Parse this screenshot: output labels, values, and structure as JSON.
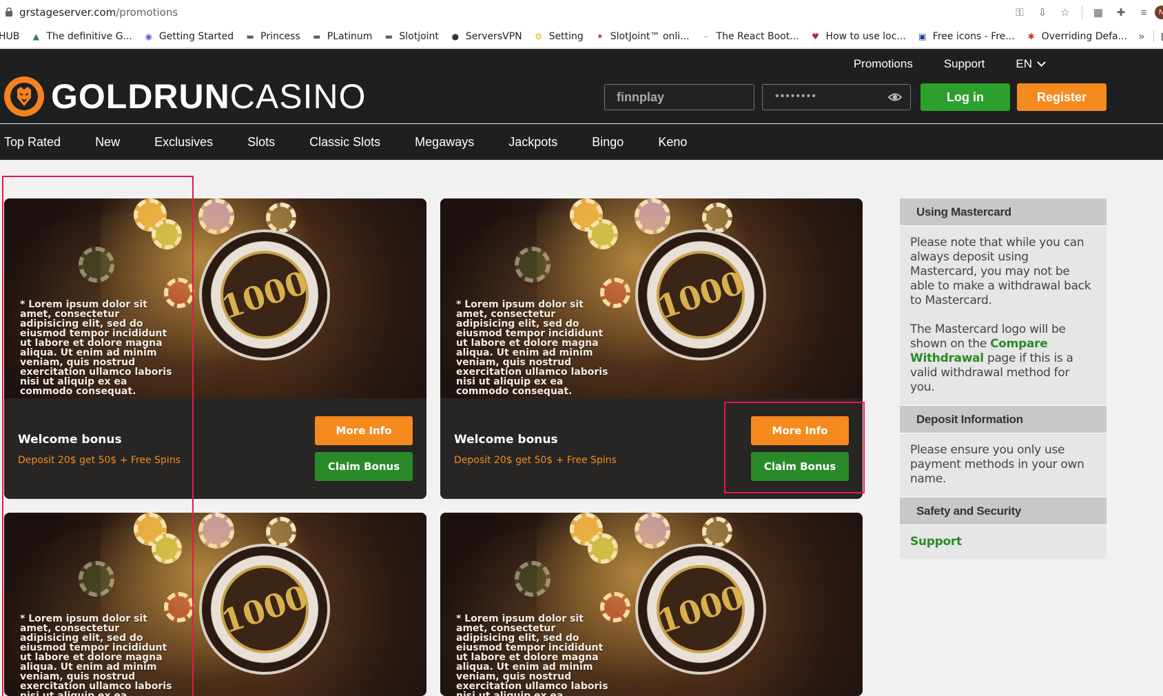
{
  "browser": {
    "url_host": "grstageserver.com",
    "url_path": "/promotions",
    "avatar_letter": "N",
    "bookmarks": [
      {
        "label": "HUB",
        "icon": "none"
      },
      {
        "label": "The definitive G...",
        "icon": "triangle-icon"
      },
      {
        "label": "Getting Started",
        "icon": "eye-logo-icon"
      },
      {
        "label": "Princess",
        "icon": "folder-icon"
      },
      {
        "label": "PLatinum",
        "icon": "folder-icon"
      },
      {
        "label": "Slotjoint",
        "icon": "folder-icon"
      },
      {
        "label": "ServersVPN",
        "icon": "globe-icon"
      },
      {
        "label": "Setting",
        "icon": "setting-icon"
      },
      {
        "label": "SlotJoint™ onli...",
        "icon": "star-logo-icon"
      },
      {
        "label": "The React Boot...",
        "icon": "bar-icon"
      },
      {
        "label": "How to use loc...",
        "icon": "gem-icon"
      },
      {
        "label": "Free icons - Fre...",
        "icon": "flaticon-icon"
      },
      {
        "label": "Overriding Defa...",
        "icon": "asterisk-icon"
      }
    ],
    "bookmarks_more": "»",
    "reading_list": "Readi"
  },
  "header": {
    "top_links": [
      "Promotions",
      "Support",
      "EN"
    ],
    "logo_bold": "GOLDRUN",
    "logo_light": "CASINO",
    "username_value": "finnplay",
    "password_mask": "••••••••",
    "login_label": "Log in",
    "register_label": "Register"
  },
  "nav": [
    "Top Rated",
    "New",
    "Exclusives",
    "Slots",
    "Classic Slots",
    "Megaways",
    "Jackpots",
    "Bingo",
    "Keno"
  ],
  "cards": [
    {
      "chip_text": "1000",
      "lorem": "* Lorem ipsum dolor sit amet, consectetur adipisicing elit, sed do eiusmod tempor incididunt ut labore et dolore magna aliqua. Ut enim ad minim veniam, quis nostrud exercitation ullamco laboris nisi ut aliquip ex ea commodo consequat.",
      "title": "Welcome bonus",
      "subtitle": "Deposit 20$ get 50$ + Free Spins",
      "more_label": "More Info",
      "claim_label": "Claim Bonus"
    },
    {
      "chip_text": "1000",
      "lorem": "* Lorem ipsum dolor sit amet, consectetur adipisicing elit, sed do eiusmod tempor incididunt ut labore et dolore magna aliqua. Ut enim ad minim veniam, quis nostrud exercitation ullamco laboris nisi ut aliquip ex ea commodo consequat.",
      "title": "Welcome bonus",
      "subtitle": "Deposit 20$ get 50$ + Free Spins",
      "more_label": "More Info",
      "claim_label": "Claim Bonus"
    },
    {
      "chip_text": "1000",
      "lorem": "* Lorem ipsum dolor sit amet, consectetur adipisicing elit, sed do eiusmod tempor incididunt ut labore et dolore magna aliqua. Ut enim ad minim veniam, quis nostrud exercitation ullamco laboris nisi ut aliquip ex ea commodo consequat."
    },
    {
      "chip_text": "1000",
      "lorem": "* Lorem ipsum dolor sit amet, consectetur adipisicing elit, sed do eiusmod tempor incididunt ut labore et dolore magna aliqua. Ut enim ad minim veniam, quis nostrud exercitation ullamco laboris nisi ut aliquip ex ea commodo consequat."
    }
  ],
  "sidebar": {
    "mastercard_title": "Using Mastercard",
    "mastercard_p1": "Please note that while you can always deposit using Mastercard, you may not be able to make a withdrawal back to Mastercard.",
    "mastercard_p2_pre": "The Mastercard logo will be shown on the ",
    "mastercard_p2_link": "Compare Withdrawal",
    "mastercard_p2_post": " page if this is a valid withdrawal method for you.",
    "deposit_title": "Deposit Information",
    "deposit_text": "Please ensure you only use payment methods in your own name.",
    "safety_title": "Safety and Security",
    "safety_link": "Support"
  },
  "colors": {
    "accent_orange": "#f58a1f",
    "accent_green": "#2ca02c",
    "header_bg": "#1d1f20",
    "highlight": "#e6194b"
  }
}
